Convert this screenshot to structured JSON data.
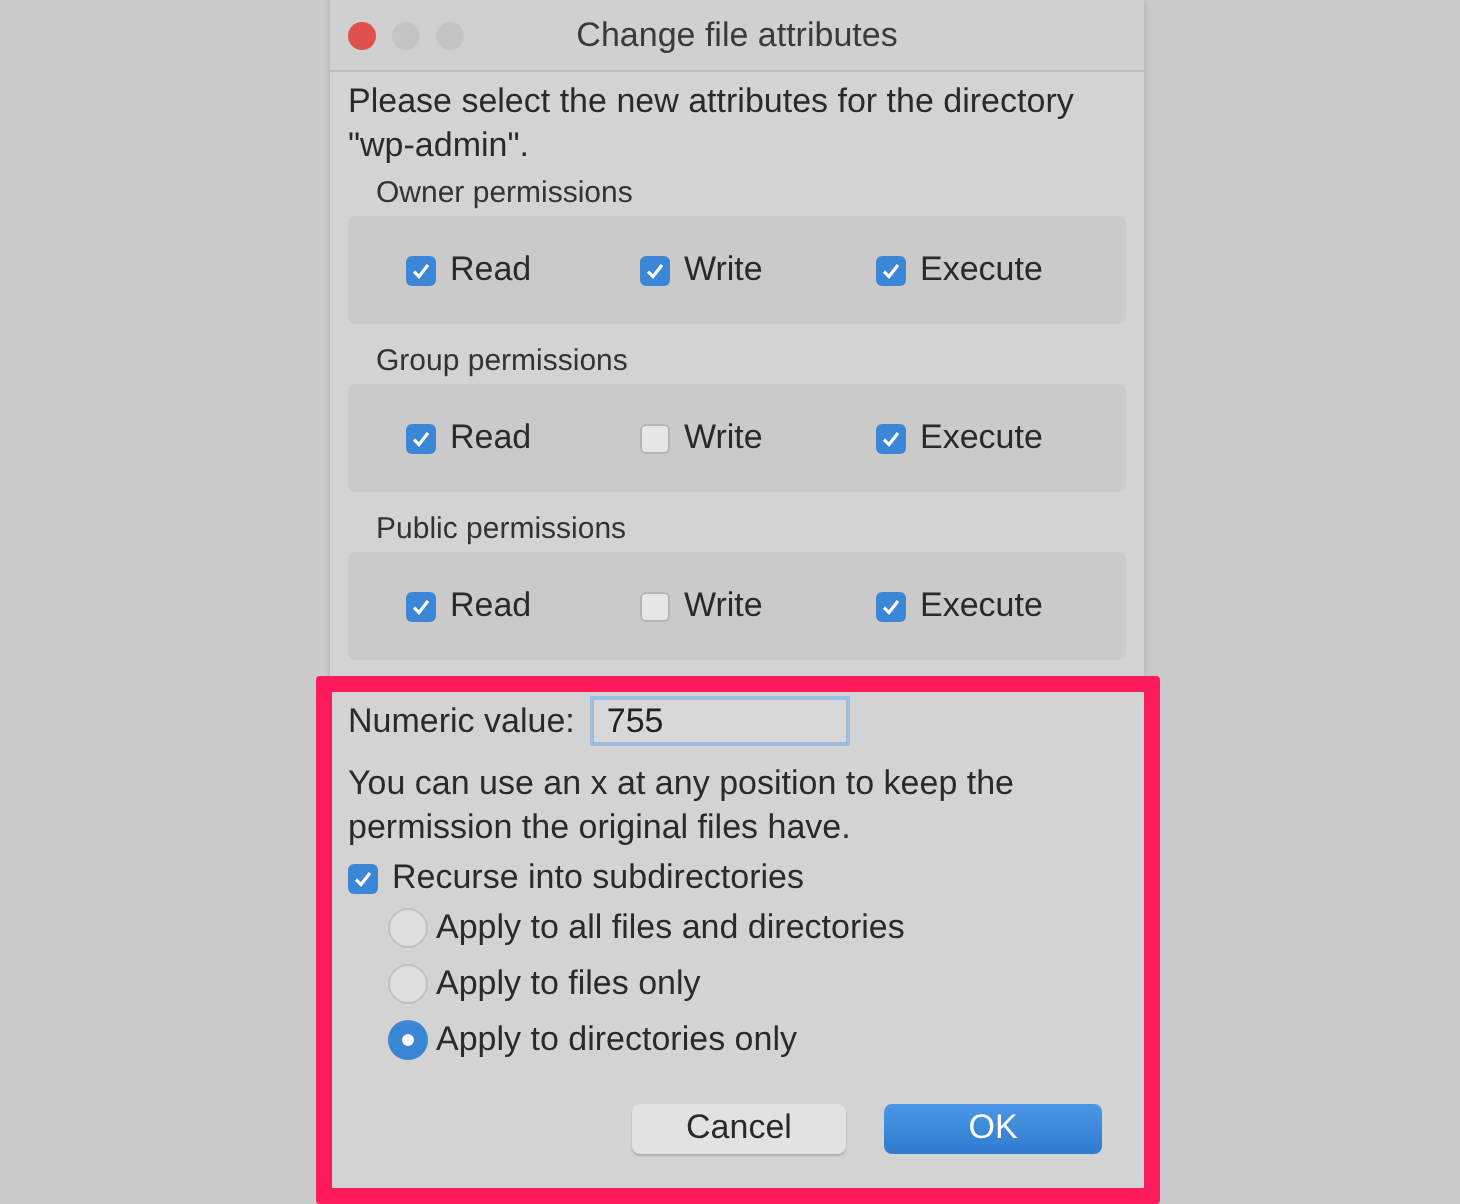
{
  "window": {
    "title": "Change file attributes"
  },
  "intro": "Please select the new attributes for the directory \"wp-admin\".",
  "groups": [
    {
      "label": "Owner permissions",
      "items": [
        {
          "label": "Read",
          "checked": true
        },
        {
          "label": "Write",
          "checked": true
        },
        {
          "label": "Execute",
          "checked": true
        }
      ]
    },
    {
      "label": "Group permissions",
      "items": [
        {
          "label": "Read",
          "checked": true
        },
        {
          "label": "Write",
          "checked": false
        },
        {
          "label": "Execute",
          "checked": true
        }
      ]
    },
    {
      "label": "Public permissions",
      "items": [
        {
          "label": "Read",
          "checked": true
        },
        {
          "label": "Write",
          "checked": false
        },
        {
          "label": "Execute",
          "checked": true
        }
      ]
    }
  ],
  "numeric": {
    "label": "Numeric value:",
    "value": "755"
  },
  "hint": "You can use an x at any position to keep the permission the original files have.",
  "recurse": {
    "label": "Recurse into subdirectories",
    "checked": true
  },
  "apply_options": [
    {
      "label": "Apply to all files and directories",
      "selected": false
    },
    {
      "label": "Apply to files only",
      "selected": false
    },
    {
      "label": "Apply to directories only",
      "selected": true
    }
  ],
  "buttons": [
    {
      "label": "Cancel",
      "kind": "secondary"
    },
    {
      "label": "OK",
      "kind": "primary"
    }
  ]
}
